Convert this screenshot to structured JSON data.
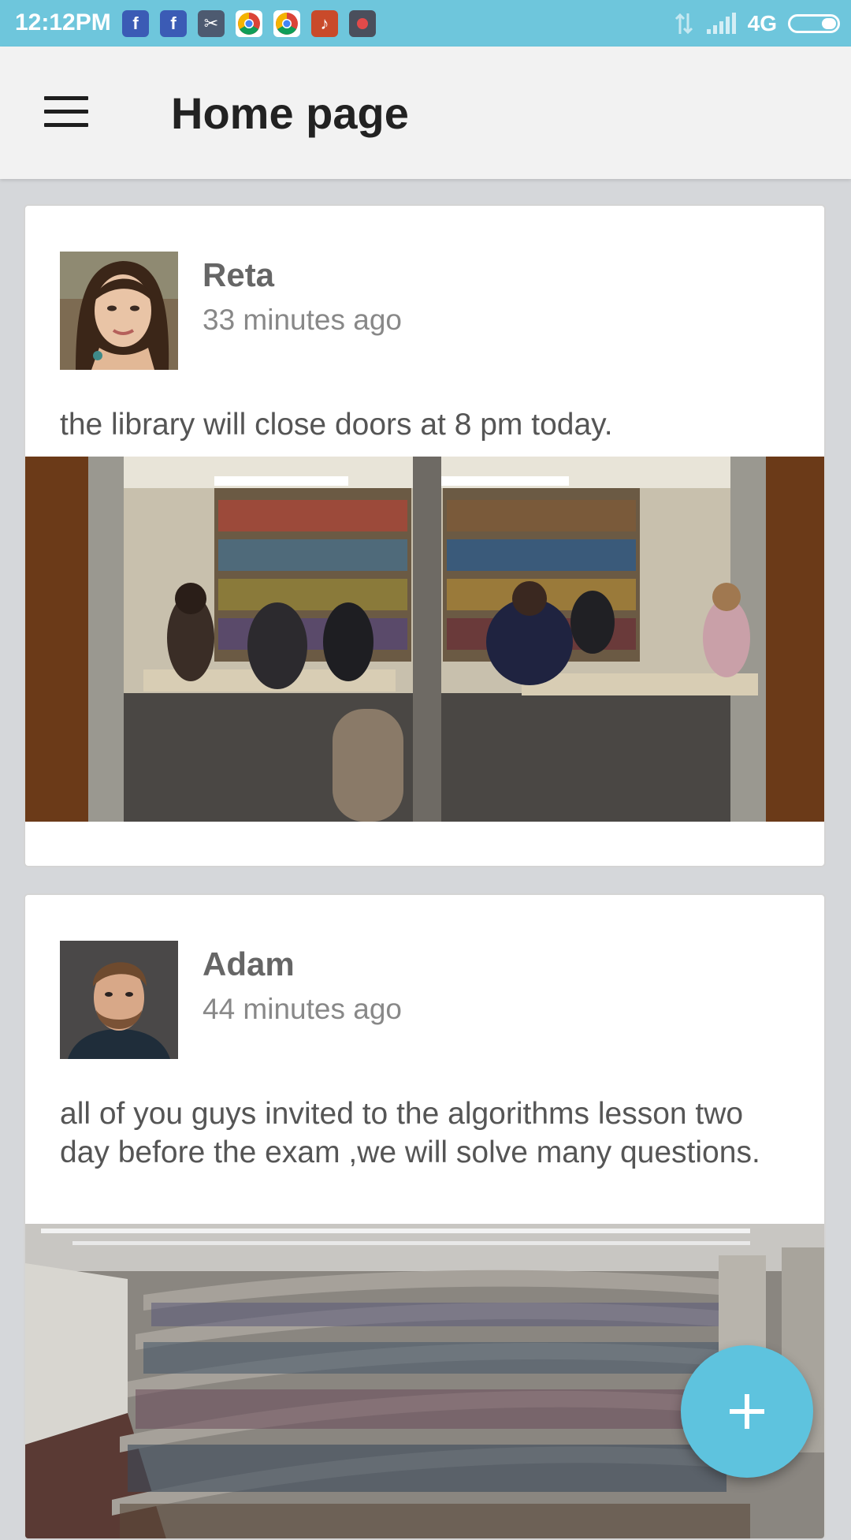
{
  "status_bar": {
    "time": "12:12PM",
    "network": "4G",
    "notification_icons": [
      "facebook-icon",
      "facebook-icon",
      "scissors-icon",
      "chrome-icon",
      "chrome-icon",
      "tiktok-icon",
      "record-icon"
    ]
  },
  "app_bar": {
    "title": "Home page"
  },
  "posts": [
    {
      "author": "Reta",
      "time": "33 minutes ago",
      "text": "the library will close doors at 8 pm today."
    },
    {
      "author": "Adam",
      "time": "44 minutes ago",
      "text": "all of you guys invited to the algorithms lesson two day before the exam ,we will solve many questions."
    }
  ],
  "colors": {
    "status_bar": "#6ec6dc",
    "app_bar": "#f2f2f2",
    "feed_background": "#d5d7da",
    "fab": "#5ec3de"
  }
}
